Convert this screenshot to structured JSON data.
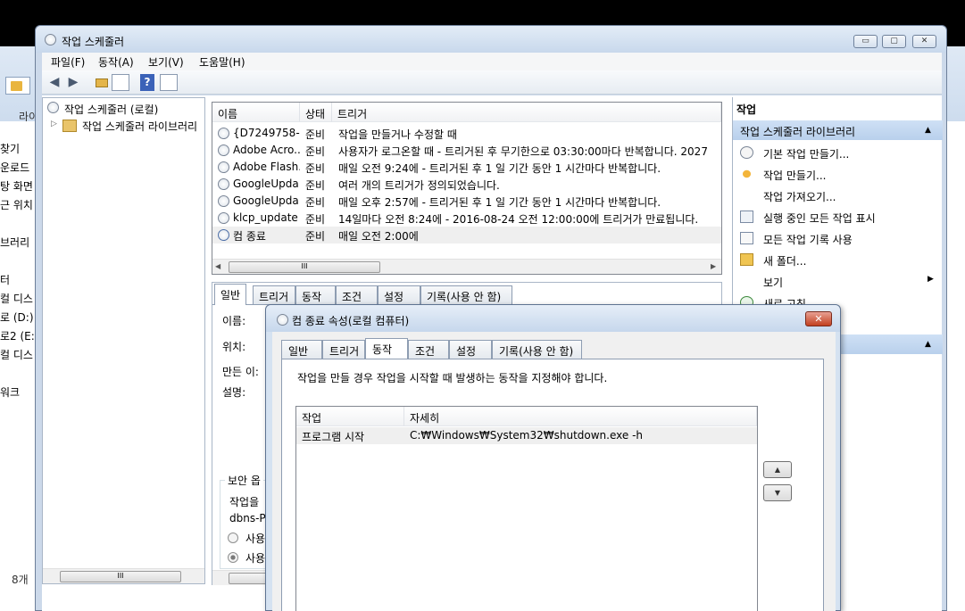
{
  "explorer": {
    "left_labels": [
      "라이",
      "찾기",
      "운로드",
      "탕 화면",
      "근 위치",
      "브러리",
      "터",
      "컬 디스",
      "로 (D:)",
      "로2 (E:)",
      "컬 디스",
      "워크"
    ],
    "status_count": "8개"
  },
  "window": {
    "title": "작업 스케줄러",
    "minimize_label": "▭",
    "maximize_label": "▢",
    "close_label": "✕"
  },
  "menu": {
    "items": [
      "파일(F)",
      "동작(A)",
      "보기(V)",
      "도움말(H)"
    ]
  },
  "toolbar": {
    "back_icon": "◀",
    "forward_icon": "▶",
    "help_icon": "?"
  },
  "tree": {
    "root_label": "작업 스케줄러 (로컬)",
    "child_label": "작업 스케줄러 라이브러리",
    "expand_glyph": "▷"
  },
  "task_list": {
    "columns": [
      "이름",
      "상태",
      "트리거"
    ],
    "rows": [
      {
        "name": "{D7249758-...",
        "status": "준비",
        "trigger": "작업을 만들거나 수정할 때"
      },
      {
        "name": "Adobe Acro...",
        "status": "준비",
        "trigger": "사용자가 로그온할 때 - 트리거된 후 무기한으로 03:30:00마다 반복합니다. 2027"
      },
      {
        "name": "Adobe Flash...",
        "status": "준비",
        "trigger": "매일 오전 9:24에 - 트리거된 후 1 일 기간 동안 1 시간마다 반복합니다."
      },
      {
        "name": "GoogleUpda...",
        "status": "준비",
        "trigger": "여러 개의 트리거가 정의되었습니다."
      },
      {
        "name": "GoogleUpda...",
        "status": "준비",
        "trigger": "매일 오후 2:57에 - 트리거된 후 1 일 기간 동안 1 시간마다 반복합니다."
      },
      {
        "name": "klcp_update",
        "status": "준비",
        "trigger": "14일마다 오전 8:24에 - 2016-08-24 오전 12:00:00에 트리거가 만료됩니다."
      },
      {
        "name": "컴 종료",
        "status": "준비",
        "trigger": "매일 오전 2:00에"
      }
    ],
    "selected_index": 6
  },
  "detail": {
    "tabs": [
      "일반",
      "트리거",
      "동작",
      "조건",
      "설정",
      "기록(사용 안 함)"
    ],
    "active_tab": 0,
    "labels": {
      "name": "이름:",
      "location": "위치:",
      "author": "만든 이:",
      "description": "설명:"
    },
    "security_group": "보안 옵",
    "security_text": "작업을",
    "security_user": "dbns-P",
    "radio1": "사용",
    "radio2": "사용"
  },
  "actions_pane": {
    "header": "작업",
    "section1": "작업 스케줄러 라이브러리",
    "items": [
      {
        "label": "기본 작업 만들기...",
        "icon": "clock-wizard-icon"
      },
      {
        "label": "작업 만들기...",
        "icon": "create-task-icon"
      },
      {
        "label": "작업 가져오기...",
        "icon": ""
      },
      {
        "label": "실행 중인 모든 작업 표시",
        "icon": "running-tasks-icon"
      },
      {
        "label": "모든 작업 기록 사용",
        "icon": "history-icon"
      },
      {
        "label": "새 폴더...",
        "icon": "folder-icon"
      },
      {
        "label": "보기",
        "icon": ""
      },
      {
        "label": "새로 고침",
        "icon": "refresh-icon"
      }
    ]
  },
  "dialog": {
    "title": "컴 종료 속성(로컬 컴퓨터)",
    "close_label": "✕",
    "tabs": [
      "일반",
      "트리거",
      "동작",
      "조건",
      "설정",
      "기록(사용 안 함)"
    ],
    "active_tab": 2,
    "description": "작업을 만들 경우 작업을 시작할 때 발생하는 동작을 지정해야 합니다.",
    "table_columns": [
      "작업",
      "자세히"
    ],
    "table_rows": [
      {
        "action": "프로그램 시작",
        "details": "C:₩Windows₩System32₩shutdown.exe -h"
      }
    ],
    "move_up": "▲",
    "move_down": "▼"
  }
}
